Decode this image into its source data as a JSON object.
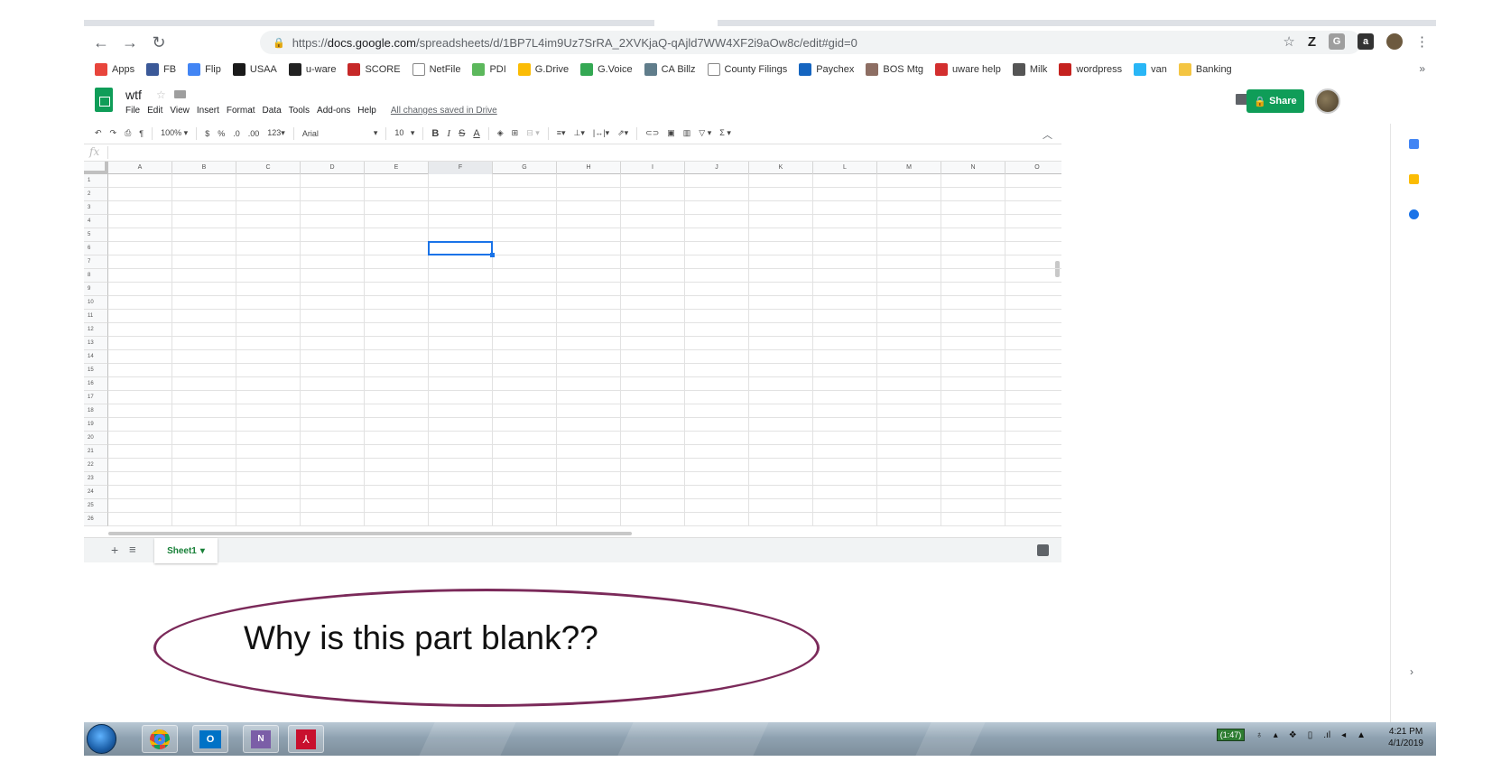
{
  "browser": {
    "url_prefix": "https://",
    "url_host": "docs.google.com",
    "url_path": "/spreadsheets/d/1BP7L4im9Uz7SrRA_2XVKjaQ-qAjld7WW4XF2i9aOw8c/edit#gid=0",
    "profile_letter": "Z",
    "bookmarks": [
      "Apps",
      "FB",
      "Flip",
      "USAA",
      "u-ware",
      "SCORE",
      "NetFile",
      "PDI",
      "G.Drive",
      "G.Voice",
      "CA Billz",
      "County Filings",
      "Paychex",
      "BOS Mtg",
      "uware help",
      "Milk",
      "wordpress",
      "van",
      "Banking"
    ],
    "bookmark_colors": [
      "#e8453c",
      "#3b5998",
      "#4285f4",
      "#1a1a1a",
      "#222",
      "#c62828",
      "#ffffff",
      "#5cb85c",
      "#fbbc05",
      "#34a853",
      "#607d8b",
      "#ffffff",
      "#1565c0",
      "#8d6e63",
      "#d32f2f",
      "#555",
      "#c5221f",
      "#29b6f6",
      "#f4c542"
    ],
    "bookmarks_more": "»"
  },
  "sheets": {
    "title": "wtf",
    "menu": [
      "File",
      "Edit",
      "View",
      "Insert",
      "Format",
      "Data",
      "Tools",
      "Add-ons",
      "Help"
    ],
    "saved_status": "All changes saved in Drive",
    "share_label": "Share",
    "toolbar": {
      "zoom": "100%",
      "currency": "$",
      "percent": "%",
      "dec_less": ".0",
      "dec_more": ".00",
      "format_more": "123",
      "font": "Arial",
      "font_size": "10",
      "bold": "B",
      "italic": "I",
      "strike": "S",
      "text_color": "A",
      "sum": "Σ"
    },
    "fx_label": "fx",
    "columns": [
      "A",
      "B",
      "C",
      "D",
      "E",
      "F",
      "G",
      "H",
      "I",
      "J",
      "K",
      "L",
      "M",
      "N",
      "O"
    ],
    "rows": [
      "1",
      "2",
      "3",
      "4",
      "5",
      "6",
      "7",
      "8",
      "9",
      "10",
      "11",
      "12",
      "13",
      "14",
      "15",
      "16",
      "17",
      "18",
      "19",
      "20",
      "21",
      "22",
      "23",
      "24",
      "25",
      "26"
    ],
    "selected_cell": "F6",
    "sheet_tab": "Sheet1"
  },
  "annotation": {
    "text": "Why is this part blank??",
    "color": "#7b2a5a"
  },
  "taskbar": {
    "battery": "(1:47)",
    "time": "4:21 PM",
    "date": "4/1/2019"
  }
}
